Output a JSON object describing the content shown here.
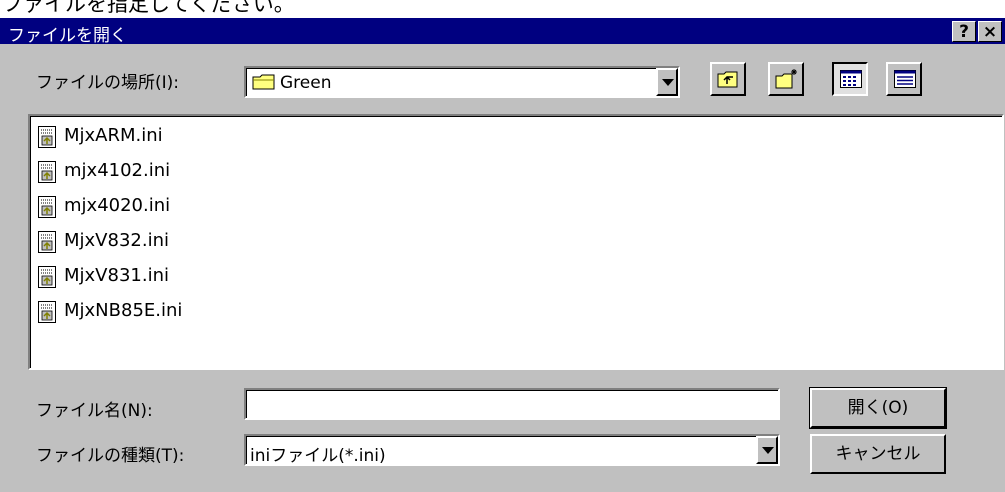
{
  "caption_fragment": "ファイルを指定してください。",
  "dialog": {
    "title": "ファイルを開く",
    "help_btn": "?",
    "close_btn": "×",
    "lookin_label": "ファイルの場所(I):",
    "lookin_value": "Green",
    "files": [
      "MjxARM.ini",
      "mjx4102.ini",
      "mjx4020.ini",
      "MjxV832.ini",
      "MjxV831.ini",
      "MjxNB85E.ini"
    ],
    "filename_label": "ファイル名(N):",
    "filename_value": "",
    "filetype_label": "ファイルの種類(T):",
    "filetype_value": "iniファイル(*.ini)",
    "open_btn": "開く(O)",
    "cancel_btn": "キャンセル"
  }
}
